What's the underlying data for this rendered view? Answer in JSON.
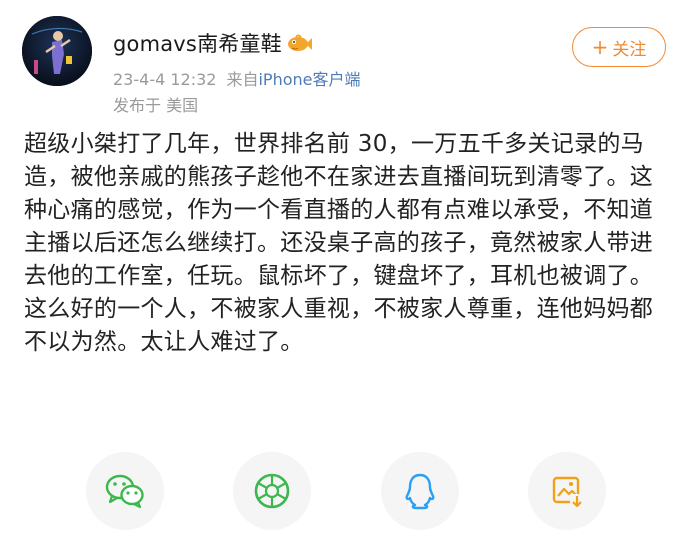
{
  "post": {
    "username": "gomavs南希童鞋",
    "timestamp": "23-4-4 12:32",
    "source_prefix": "来自",
    "source_client": "iPhone客户端",
    "location": "发布于 美国",
    "follow_label": "关注",
    "follow_plus": "+",
    "body": "超级小桀打了几年，世界排名前 30，一万五千多关记录的马造，被他亲戚的熊孩子趁他不在家进去直播间玩到清零了。这种心痛的感觉，作为一个看直播的人都有点难以承受，不知道主播以后还怎么继续打。还没桌子高的孩子，竟然被家人带进去他的工作室，任玩。鼠标坏了，键盘坏了，耳机也被调了。这么好的一个人，不被家人重视，不被家人尊重，连他妈妈都不以为然。太让人难过了。"
  },
  "share": {
    "buttons": [
      {
        "icon": "wechat-icon",
        "color": "#3cb74d"
      },
      {
        "icon": "moments-icon",
        "color": "#3cb74d"
      },
      {
        "icon": "qq-icon",
        "color": "#2b9ef5"
      },
      {
        "icon": "save-image-icon",
        "color": "#f0a019"
      }
    ]
  },
  "colors": {
    "accent": "#f08a34",
    "link": "#4f7cb6",
    "meta": "#9a9a9a",
    "text": "#222222"
  }
}
